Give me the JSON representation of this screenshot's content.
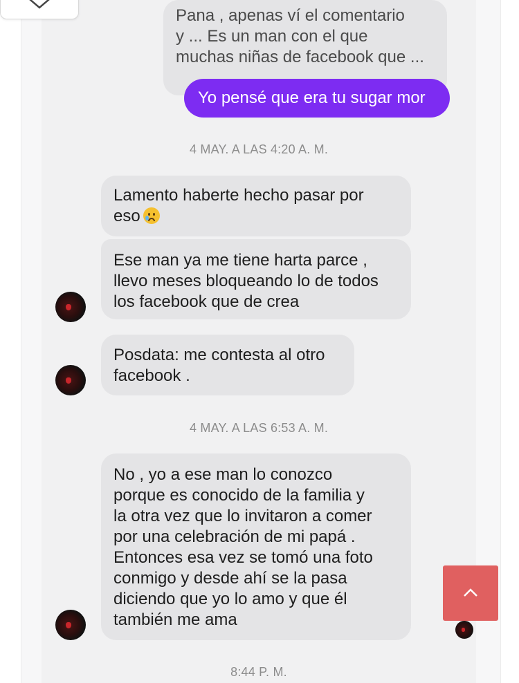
{
  "conversation": {
    "outgoing": {
      "grey_lines": [
        "Pana , apenas ví el comentario",
        "y ... Es un man con el que",
        "muchas niñas de facebook que ..."
      ],
      "purple_text": "Yo pensé que era tu sugar mor",
      "purple_color": "#7d2cf2"
    },
    "timestamps": {
      "first": "4 MAY. A LAS 4:20 A. M.",
      "second": "4 MAY. A LAS 6:53 A. M.",
      "third": "8:44 P. M."
    },
    "incoming": {
      "message_1": {
        "line_1": "Lamento haberte hecho pasar por",
        "line_2": "eso",
        "emoji": "crying-face-icon"
      },
      "message_2": [
        "Ese man ya me tiene harta parce ,",
        "llevo meses bloqueando lo de todos",
        "los facebook que de crea"
      ],
      "message_3": [
        "Posdata: me contesta al otro",
        "facebook ."
      ],
      "message_4": [
        "No , yo a ese man lo conozco",
        "porque es conocido de la familia y",
        "la otra vez que lo invitaron a comer",
        "por una celebración de mi papá .",
        "Entonces esa vez se tomó una foto",
        "conmigo y desde ahí se la pasa",
        "diciendo que yo lo amo y que él",
        "también me ama"
      ]
    }
  },
  "controls": {
    "close_icon": "close-icon",
    "scroll_top_icon": "chevron-up-icon",
    "scroll_top_color": "#e06060"
  }
}
